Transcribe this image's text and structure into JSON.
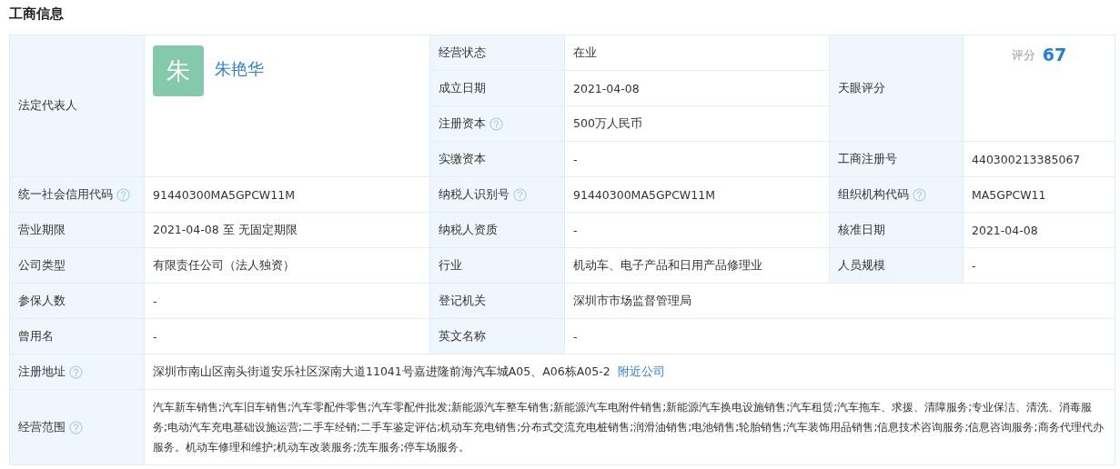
{
  "title": "工商信息",
  "fields": [
    {
      "kind": "person",
      "label": "法定代表人",
      "avatar": "朱",
      "name": "朱艳华"
    },
    {
      "kind": "plain",
      "label": "经营状态",
      "value": "在业"
    },
    {
      "kind": "plain",
      "label": "成立日期",
      "value": "2021-04-08"
    },
    {
      "kind": "plain",
      "label": "注册资本",
      "help": true,
      "value": "500万人民币"
    },
    {
      "kind": "plain",
      "label": "实缴资本",
      "value": "-"
    },
    {
      "kind": "score",
      "label": "天眼评分",
      "score_label": "评分",
      "score": "67"
    },
    {
      "kind": "plain",
      "label": "工商注册号",
      "value": "440300213385067"
    },
    {
      "kind": "plain",
      "label": "统一社会信用代码",
      "help": true,
      "value": "91440300MA5GPCW11M"
    },
    {
      "kind": "plain",
      "label": "纳税人识别号",
      "help": true,
      "value": "91440300MA5GPCW11M"
    },
    {
      "kind": "plain",
      "label": "组织机构代码",
      "help": true,
      "value": "MA5GPCW11"
    },
    {
      "kind": "plain",
      "label": "营业期限",
      "value": "2021-04-08  至 无固定期限"
    },
    {
      "kind": "plain",
      "label": "纳税人资质",
      "value": "-"
    },
    {
      "kind": "plain",
      "label": "核准日期",
      "value": "2021-04-08"
    },
    {
      "kind": "plain",
      "label": "公司类型",
      "value": "有限责任公司（法人独资）"
    },
    {
      "kind": "plain",
      "label": "行业",
      "value": "机动车、电子产品和日用产品修理业"
    },
    {
      "kind": "plain",
      "label": "人员规模",
      "value": "-"
    },
    {
      "kind": "plain",
      "label": "参保人数",
      "value": "-"
    },
    {
      "kind": "plain",
      "label": "登记机关",
      "value": "深圳市市场监督管理局"
    },
    {
      "kind": "plain",
      "label": "曾用名",
      "value": "-"
    },
    {
      "kind": "plain",
      "label": "英文名称",
      "value": "-"
    },
    {
      "kind": "address",
      "label": "注册地址",
      "help": true,
      "value": "深圳市南山区南头街道安乐社区深南大道11041号嘉进隆前海汽车城A05、A06栋A05-2",
      "link": "附近公司"
    },
    {
      "kind": "plain",
      "label": "经营范围",
      "help": true,
      "value": "汽车新车销售;汽车旧车销售;汽车零配件零售;汽车零配件批发;新能源汽车整车销售;新能源汽车电附件销售;新能源汽车换电设施销售;汽车租赁;汽车拖车、求援、清障服务;专业保洁、清洗、消毒服务;电动汽车充电基础设施运营;二手车经销;二手车鉴定评估;机动车充电销售;分布式交流充电桩销售;润滑油销售;电池销售;轮胎销售;汽车装饰用品销售;信息技术咨询服务;信息咨询服务;商务代理代办服务。机动车修理和维护;机动车改装服务;洗车服务;停车场服务。"
    }
  ]
}
